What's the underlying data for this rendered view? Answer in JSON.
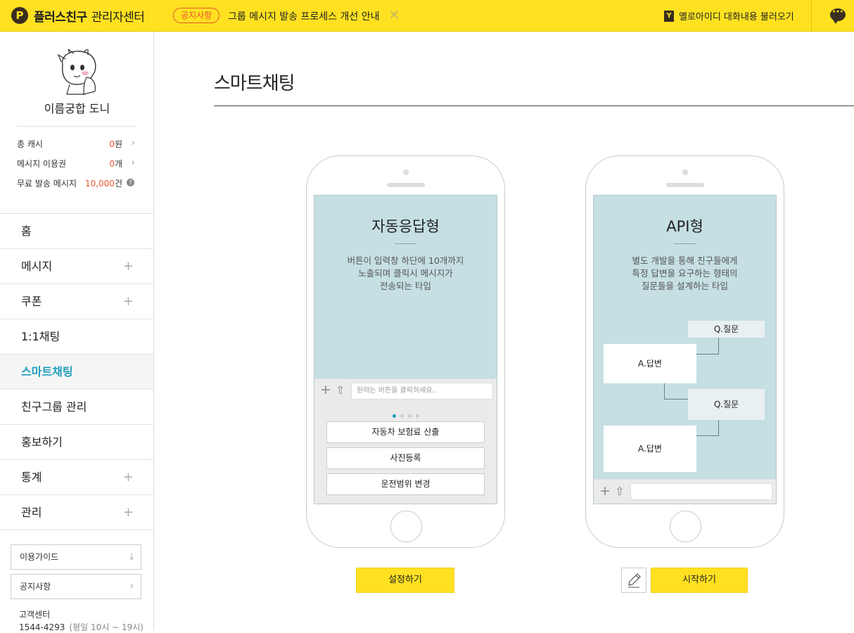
{
  "topbar": {
    "logo_mark": "P",
    "logo_title": "플러스친구",
    "logo_subtitle": "관리자센터",
    "notice_badge": "공지사항",
    "notice_text": "그룹 메시지 발송 프로세스 개선 안내",
    "yellowid_link": "옐로아이디 대화내용 불러오기",
    "yellowid_icon_letter": "Y"
  },
  "sidebar": {
    "profile_name": "이름궁합 도니",
    "stats": [
      {
        "label": "총 캐시",
        "value": "0",
        "unit": "원"
      },
      {
        "label": "메시지 이용권",
        "value": "0",
        "unit": "개"
      },
      {
        "label": "무료 발송 메시지",
        "value": "10,000",
        "unit": "건"
      }
    ],
    "menu": [
      {
        "label": "홈",
        "expandable": false
      },
      {
        "label": "메시지",
        "expandable": true
      },
      {
        "label": "쿠폰",
        "expandable": true
      },
      {
        "label": "1:1채팅",
        "expandable": false
      },
      {
        "label": "스마트채팅",
        "expandable": false,
        "active": true
      },
      {
        "label": "친구그룹 관리",
        "expandable": false
      },
      {
        "label": "홍보하기",
        "expandable": false
      },
      {
        "label": "통계",
        "expandable": true
      },
      {
        "label": "관리",
        "expandable": true
      }
    ],
    "guide_button": "이용가이드",
    "notice_button": "공지사항",
    "cs_label": "고객센터",
    "cs_phone": "1544-4293",
    "cs_hours": "(평일 10시 ~ 19시)"
  },
  "main": {
    "title": "스마트채팅",
    "auto": {
      "title": "자동응답형",
      "desc": [
        "버튼이 입력창 하단에 10개까지",
        "노출되며 클릭시 메시지가",
        "전송되는 타입"
      ],
      "input_placeholder": "원하는 버튼을 클릭하세요..",
      "buttons": [
        "자동차 보험료 산출",
        "사진등록",
        "운전범위 변경"
      ],
      "action": "설정하기"
    },
    "api": {
      "title": "API형",
      "desc": [
        "별도 개발을 통해 친구들에게",
        "특정 답변을 요구하는 형태의",
        "질문들을 설계하는 타입"
      ],
      "flow": [
        "Q.질문",
        "A.답변",
        "Q.질문",
        "A.답변"
      ],
      "action": "시작하기"
    }
  },
  "colors": {
    "brand_yellow": "#ffe121",
    "accent_blue": "#1f9fbb",
    "alert_orange": "#e8552d",
    "screen_teal": "#c5dfe3"
  }
}
